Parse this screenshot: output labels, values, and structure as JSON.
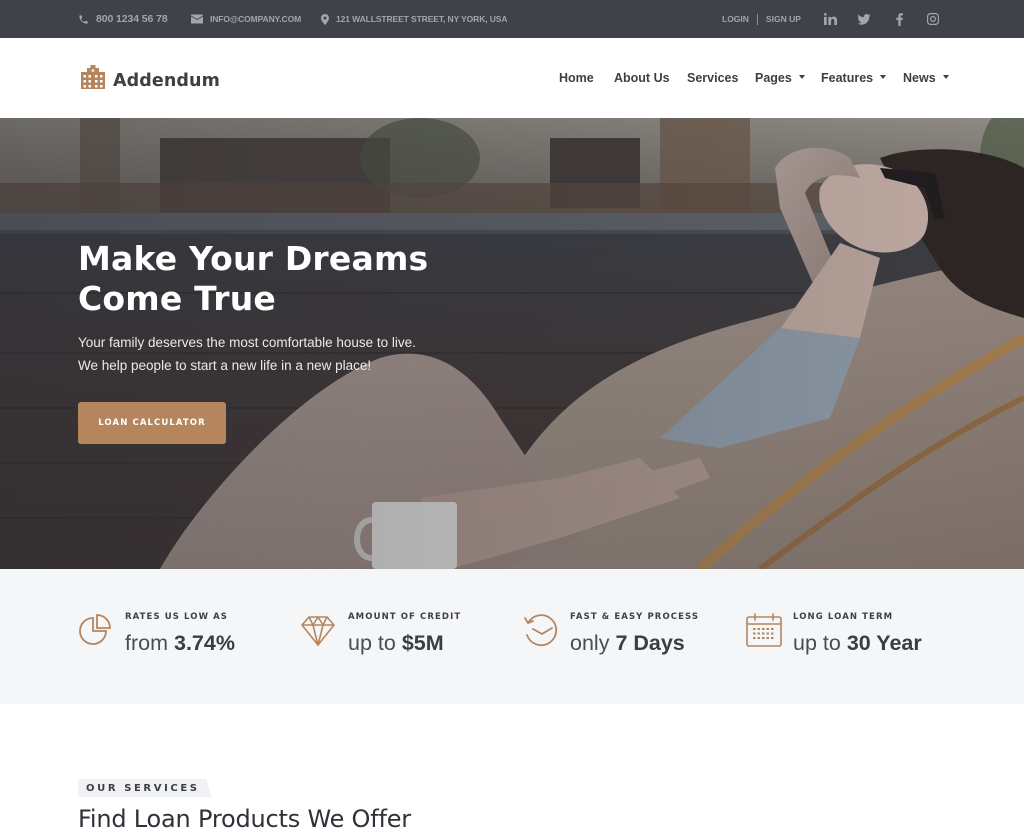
{
  "topbar": {
    "phone": "800 1234 56 78",
    "email": "INFO@COMPANY.COM",
    "address": "121 WALLSTREET STREET, NY YORK, USA",
    "login": "LOGIN",
    "signup": "SIGN UP",
    "social": [
      "linkedin-icon",
      "twitter-icon",
      "facebook-icon",
      "instagram-icon"
    ]
  },
  "header": {
    "brand": "Addendum",
    "nav": [
      {
        "label": "Home",
        "dropdown": false
      },
      {
        "label": "About Us",
        "dropdown": false
      },
      {
        "label": "Services",
        "dropdown": false
      },
      {
        "label": "Pages",
        "dropdown": true
      },
      {
        "label": "Features",
        "dropdown": true
      },
      {
        "label": "News",
        "dropdown": true
      }
    ]
  },
  "hero": {
    "title_line1": "Make Your Dreams",
    "title_line2": "Come True",
    "subtitle_line1": "Your family deserves the most comfortable house to live.",
    "subtitle_line2": "We help people to start a new life in a new place!",
    "button": "LOAN CALCULATOR"
  },
  "stats": [
    {
      "icon": "pie-chart-icon",
      "label": "RATES US LOW AS",
      "prefix": "from",
      "value": "3.74%"
    },
    {
      "icon": "diamond-icon",
      "label": "AMOUNT OF CREDIT",
      "prefix": "up to",
      "value": "$5M"
    },
    {
      "icon": "clock-history-icon",
      "label": "FAST & EASY PROCESS",
      "prefix": "only",
      "value": "7 Days"
    },
    {
      "icon": "calendar-icon",
      "label": "LONG LOAN TERM",
      "prefix": "up to",
      "value": "30 Year"
    }
  ],
  "services": {
    "tag": "OUR SERVICES",
    "title": "Find Loan Products We Offer"
  },
  "colors": {
    "accent": "#b5865e",
    "topbar_bg": "#3f4248",
    "stats_bg": "#f5f6f8",
    "text_dark": "#3c3f45"
  }
}
